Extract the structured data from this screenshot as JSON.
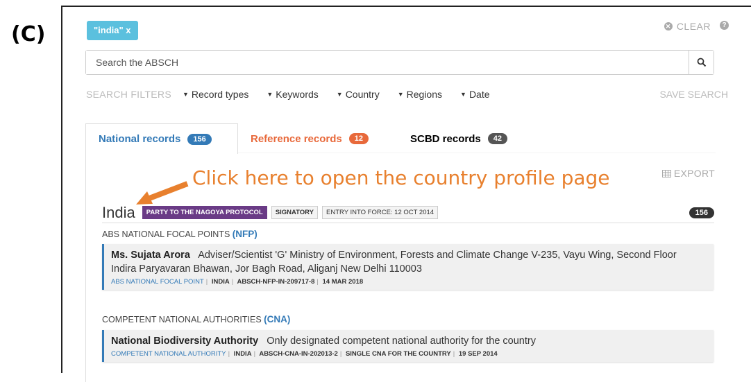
{
  "panel_label": "(C)",
  "search": {
    "active_tag": "\"india\" x",
    "clear_label": "CLEAR",
    "placeholder": "Search the ABSCH"
  },
  "filters": {
    "label": "SEARCH FILTERS",
    "items": [
      "Record types",
      "Keywords",
      "Country",
      "Regions",
      "Date"
    ],
    "save_label": "SAVE SEARCH"
  },
  "tabs": [
    {
      "label": "National records",
      "count": "156"
    },
    {
      "label": "Reference records",
      "count": "12"
    },
    {
      "label": "SCBD records",
      "count": "42"
    }
  ],
  "export_label": "EXPORT",
  "callout": "Click here to open the country profile page",
  "country": {
    "name": "India",
    "party_status": "PARTY TO THE NAGOYA PROTOCOL",
    "signatory": "SIGNATORY",
    "entry_into_force": "ENTRY INTO FORCE: 12 OCT 2014",
    "count": "156"
  },
  "sections": [
    {
      "title": "ABS NATIONAL FOCAL POINTS",
      "abbr": "(NFP)",
      "record": {
        "name": "Ms. Sujata Arora",
        "description_line1": "Adviser/Scientist 'G' Ministry of Environment, Forests and Climate Change V-235, Vayu Wing, Second Floor",
        "description_line2": "Indira Paryavaran Bhawan, Jor Bagh Road, Aliganj New Delhi 110003",
        "type": "ABS NATIONAL FOCAL POINT",
        "meta": [
          "INDIA",
          "ABSCH-NFP-IN-209717-8",
          "14 MAR 2018"
        ]
      }
    },
    {
      "title": "COMPETENT NATIONAL AUTHORITIES",
      "abbr": "(CNA)",
      "record": {
        "name": "National Biodiversity Authority",
        "description_line1": "Only designated competent national authority for the country",
        "type": "COMPETENT NATIONAL AUTHORITY",
        "meta": [
          "INDIA",
          "ABSCH-CNA-IN-202013-2",
          "SINGLE CNA FOR THE COUNTRY",
          "19 SEP 2014"
        ]
      }
    }
  ],
  "colors": {
    "accent_blue": "#337ab7",
    "reference_orange": "#e8693b",
    "party_purple": "#6a3b86",
    "callout_orange": "#e8802e",
    "tag_cyan": "#5bc0de"
  }
}
